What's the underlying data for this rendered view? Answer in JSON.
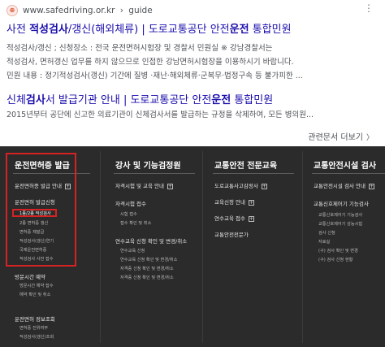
{
  "source": {
    "url": "www.safedriving.or.kr",
    "sep": "›",
    "path": "guide",
    "favicon_glyph": "⊕"
  },
  "result1": {
    "title_part1": "사전 ",
    "title_bold1": "적성검사",
    "title_part2": "/갱신(해외체류) | 도로교통공단 안전",
    "title_bold2": "운전",
    "title_part3": " 통합민원",
    "snippet_line1": "적성검사/갱신 ; 신청장소 : 전국 운전면허시험장 및 경찰서 민원실 ※ 강남경찰서는",
    "snippet_line2": "적성검사, 면허갱신 업무를 하지 않으므로 인접한 강남면허시험장을 이용하시기 바랍니다.",
    "snippet_line3": "민원 내용 : 정기적성검사(갱신) 기간에 질병 ·재난·해외체류·군복무·법정구속 등 불가피한 ..."
  },
  "result2": {
    "title_part1": "신체",
    "title_bold1": "검사",
    "title_part2": "서 발급기관 안내 | 도로교통공단 안전",
    "title_bold2": "운전",
    "title_part3": " 통합민원",
    "snippet_line1": "2015년부터 공단에 신고한 의료기관이 신체검사서를 발급하는 규정을 삭제하여, 모든 병의원..."
  },
  "related": {
    "label": "관련문서 더보기",
    "chevron": "〉"
  },
  "sitemap": {
    "col1": {
      "head": "운전면허증 발급",
      "items": [
        {
          "label": "운전면허증 발급 안내",
          "plus": "+"
        },
        {
          "label": "운전면허 발급신청",
          "plus": ""
        }
      ],
      "sub1": [
        "1종/2종 적성검사",
        "2종 면허증 갱신",
        "면허증 재발급",
        "적성검사(갱신)연기",
        "국제운전면허증",
        "적성검사 사전 접수"
      ],
      "item3": "방문시간 예약",
      "sub2": [
        "방문시간 예약 접수",
        "예약 확인 및 취소"
      ],
      "item4": "운전면허 정보조회",
      "sub3": [
        "면허증 진위여부",
        "적성검사(갱신)조회"
      ]
    },
    "col2": {
      "head": "강사 및 기능검정원",
      "items": [
        {
          "label": "자격시험 및 교육 안내",
          "plus": "+"
        },
        {
          "label": "자격시험 접수",
          "plus": ""
        }
      ],
      "sub1": [
        "시험 접수",
        "접수 확인 및 취소"
      ],
      "item3": "연수교육 신청 확인 및 변경/취소",
      "sub2": [
        "연수교육 신청",
        "연수교육 신청 확인 및 변경/취소",
        "자격증 신청 확인 및 변경/취소",
        "자격증 신청 확인 및 변경/취소"
      ]
    },
    "col3": {
      "head": "교통안전 전문교육",
      "items": [
        {
          "label": "도로교통사고감정사",
          "plus": "+"
        },
        {
          "label": "교육신청 안내",
          "plus": "+"
        },
        {
          "label": "연수교육 접수",
          "plus": "+"
        },
        {
          "label": "교통안전전문가",
          "plus": ""
        }
      ]
    },
    "col4": {
      "head": "교통안전시설 검사",
      "items": [
        {
          "label": "교통안전시설 검사 안내",
          "plus": "+"
        },
        {
          "label": "교통신호제어기 기능검사",
          "plus": ""
        }
      ],
      "sub1": [
        "교통신호제어기 기능검사",
        "교통신호제어기 성능시험",
        "검사 신청",
        "자료실",
        "(구) 검사 확인 및 변경",
        "(구) 검사 신청 현황"
      ]
    }
  }
}
